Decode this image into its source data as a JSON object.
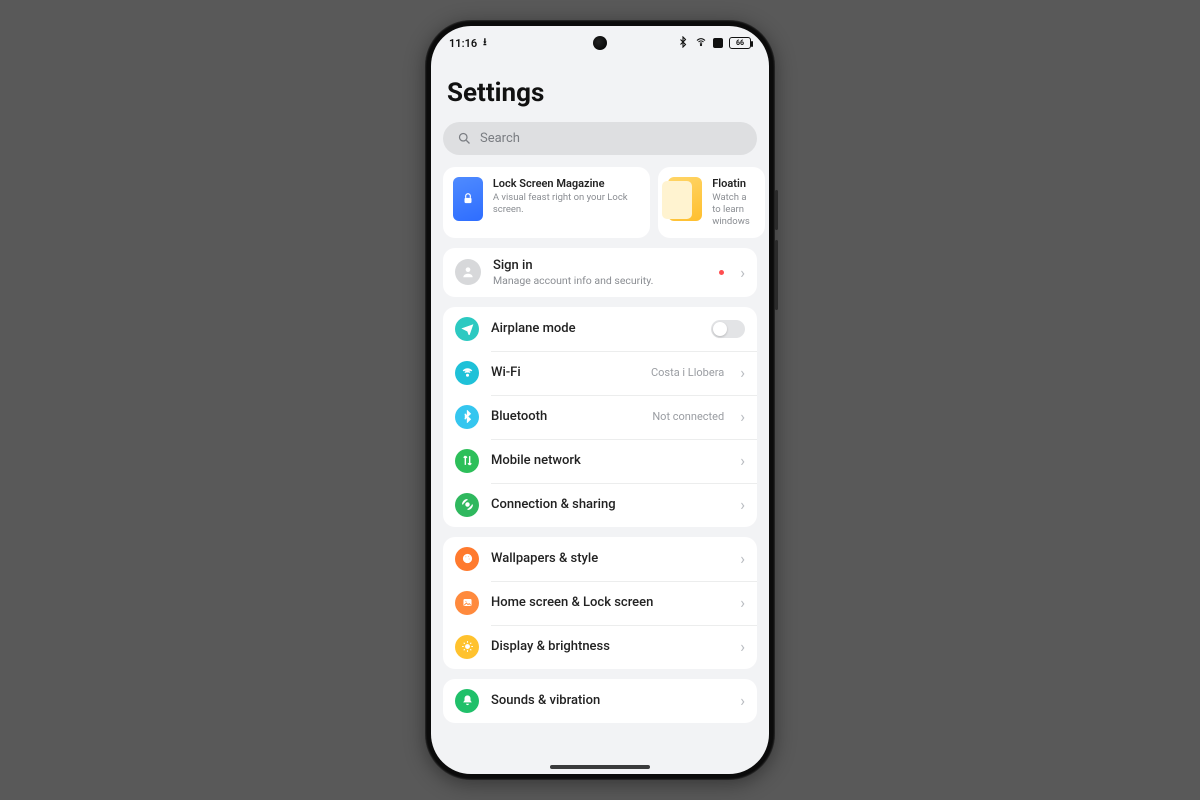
{
  "statusbar": {
    "time": "11:16",
    "battery": "66"
  },
  "page": {
    "title": "Settings"
  },
  "search": {
    "placeholder": "Search"
  },
  "promo": {
    "lockscreen": {
      "title": "Lock Screen Magazine",
      "subtitle": "A visual feast right on your Lock screen."
    },
    "floating": {
      "title": "Floatin",
      "subtitle": "Watch a\nto learn\nwindows"
    }
  },
  "account": {
    "title": "Sign in",
    "subtitle": "Manage account info and security."
  },
  "network": {
    "airplane": {
      "label": "Airplane mode"
    },
    "wifi": {
      "label": "Wi-Fi",
      "value": "Costa i Llobera"
    },
    "bluetooth": {
      "label": "Bluetooth",
      "value": "Not connected"
    },
    "mobile": {
      "label": "Mobile network"
    },
    "connection": {
      "label": "Connection & sharing"
    }
  },
  "personalization": {
    "wallpapers": {
      "label": "Wallpapers & style"
    },
    "homescreen": {
      "label": "Home screen & Lock screen"
    },
    "display": {
      "label": "Display & brightness"
    }
  },
  "sound": {
    "sounds": {
      "label": "Sounds & vibration"
    }
  }
}
